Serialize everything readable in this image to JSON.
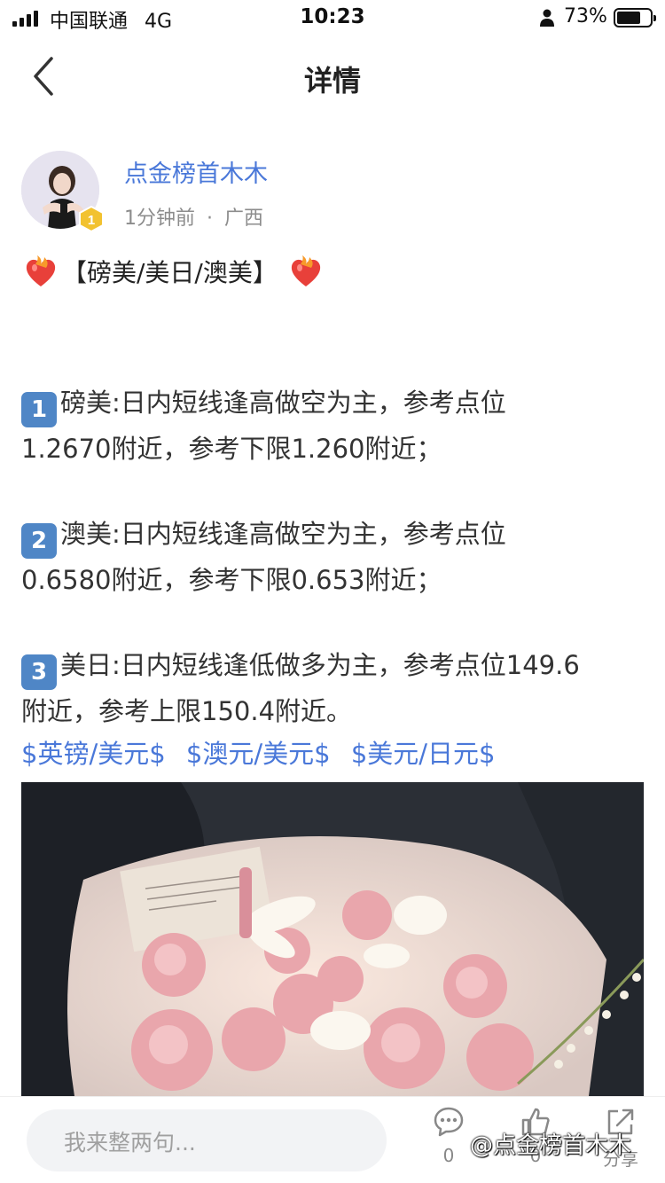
{
  "status_bar": {
    "carrier": "中国联通",
    "network": "4G",
    "time": "10:23",
    "battery_percent": "73%",
    "battery_level": 0.73
  },
  "nav": {
    "title": "详情",
    "back_icon": "chevron-left-icon"
  },
  "author": {
    "name": "点金榜首木木",
    "level": "1",
    "time_ago": "1分钟前",
    "separator": "·",
    "location": "广西"
  },
  "post": {
    "title": "【磅美/美日/澳美】",
    "items": [
      {
        "key": "1",
        "line1": "磅美:日内短线逢高做空为主，参考点位",
        "line2": "1.2670附近，参考下限1.260附近；"
      },
      {
        "key": "2",
        "line1": "澳美:日内短线逢高做空为主，参考点位",
        "line2": "0.6580附近，参考下限0.653附近；"
      },
      {
        "key": "3",
        "line1": "美日:日内短线逢低做多为主，参考点位149.6",
        "line2": "附近，参考上限150.4附近。"
      }
    ],
    "tags": [
      "$英镑/美元$",
      "$澳元/美元$",
      "$美元/日元$"
    ]
  },
  "bottom_bar": {
    "comment_placeholder": "我来整两句...",
    "comment_count": "0",
    "like_count": "0",
    "share_label": "分享",
    "watermark": "@点金榜首木木"
  },
  "colors": {
    "link_blue": "#4a78d9",
    "keycap_blue": "#4f86c6",
    "badge_gold": "#f2c230"
  }
}
